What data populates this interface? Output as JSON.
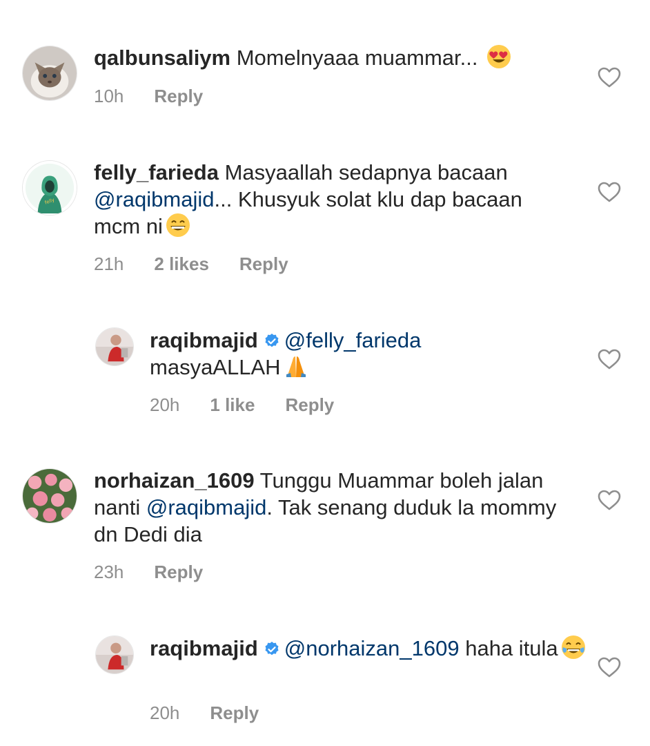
{
  "comments": [
    {
      "username": "qalbunsaliym",
      "text": "Momelnyaaa muammar...",
      "emoji": "heart-eyes-emoji",
      "time": "10h",
      "likes": "",
      "reply_label": "Reply",
      "avatar": "cat-avatar"
    },
    {
      "username": "felly_farieda",
      "text_before": "Masyaallah sedapnya bacaan",
      "mention": "@raqibmajid",
      "text_after": "... Khusyuk solat klu dap bacaan mcm ni",
      "emoji": "grin-emoji",
      "time": "21h",
      "likes": "2 likes",
      "reply_label": "Reply",
      "avatar": "illustrated-woman-avatar"
    },
    {
      "username": "raqibmajid",
      "verified": true,
      "mention": "@felly_farieda",
      "text_after": "masyaALLAH",
      "emoji": "folded-hands-emoji",
      "time": "20h",
      "likes": "1 like",
      "reply_label": "Reply",
      "avatar": "photo-avatar"
    },
    {
      "username": "norhaizan_1609",
      "text_before": "Tunggu Muammar boleh jalan nanti",
      "mention": "@raqibmajid",
      "text_after": ". Tak senang duduk la mommy dn Dedi dia",
      "time": "23h",
      "likes": "",
      "reply_label": "Reply",
      "avatar": "roses-avatar"
    },
    {
      "username": "raqibmajid",
      "verified": true,
      "mention": "@norhaizan_1609",
      "text_after": "haha itula",
      "emoji": "tears-of-joy-emoji",
      "time": "20h",
      "likes": "",
      "reply_label": "Reply",
      "avatar": "photo-avatar"
    }
  ],
  "colors": {
    "text": "#262626",
    "muted": "#8e8e8e",
    "mention": "#00376b",
    "verified": "#3897f0"
  }
}
